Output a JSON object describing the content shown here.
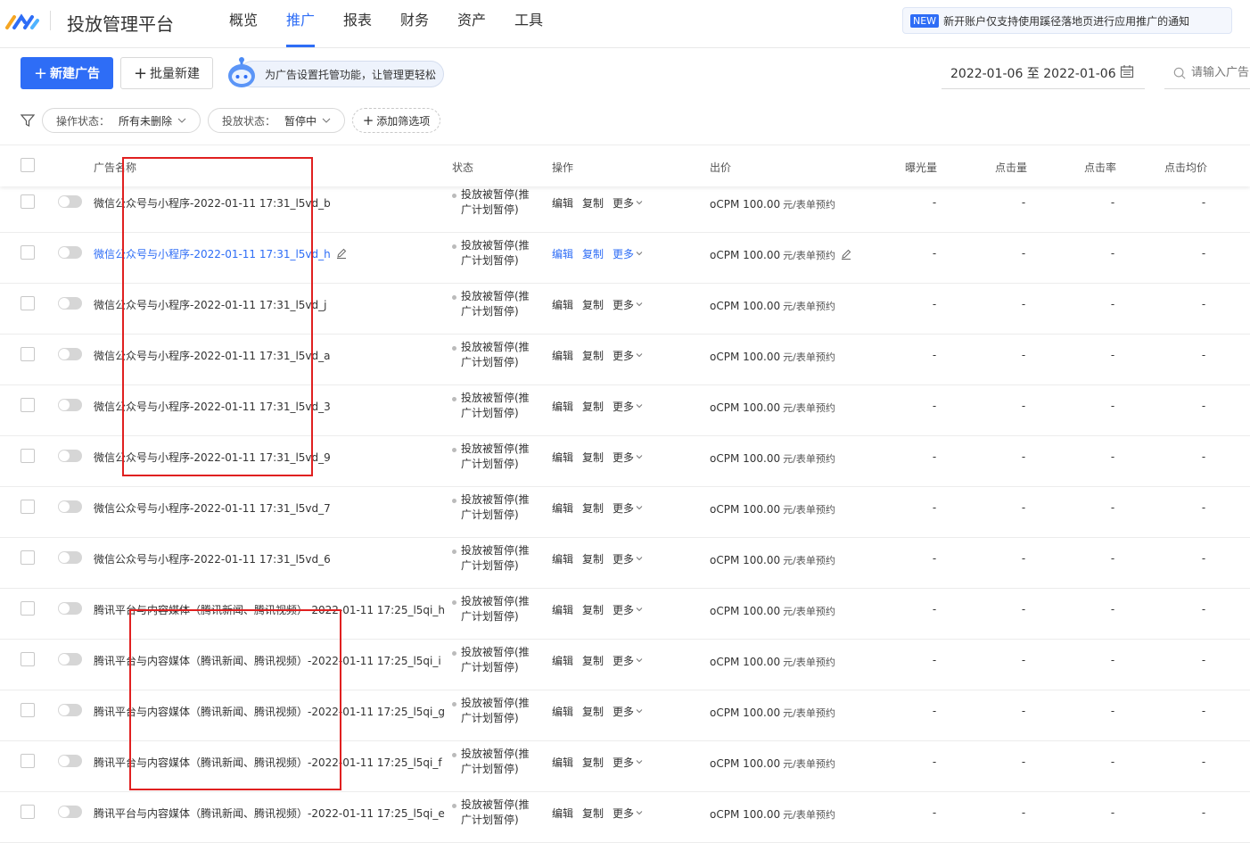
{
  "app": {
    "title": "投放管理平台"
  },
  "nav": [
    {
      "label": "概览",
      "active": false
    },
    {
      "label": "推广",
      "active": true
    },
    {
      "label": "报表",
      "active": false
    },
    {
      "label": "财务",
      "active": false
    },
    {
      "label": "资产",
      "active": false
    },
    {
      "label": "工具",
      "active": false
    }
  ],
  "notice": {
    "tag": "NEW",
    "text": "新开账户仅支持使用蹊径落地页进行应用推广的通知"
  },
  "toolbar": {
    "new_ad": "新建广告",
    "batch_new": "批量新建",
    "hint": "为广告设置托管功能，让管理更轻松",
    "date_range": "2022-01-06 至 2022-01-06",
    "search_placeholder": "请输入广告"
  },
  "filters": {
    "op_status_label": "操作状态：",
    "op_status_value": "所有未删除",
    "delivery_status_label": "投放状态：",
    "delivery_status_value": "暂停中",
    "add_filter": "添加筛选项"
  },
  "table": {
    "headers": {
      "name": "广告名称",
      "status": "状态",
      "ops": "操作",
      "bid": "出价",
      "impressions": "曝光量",
      "clicks": "点击量",
      "ctr": "点击率",
      "cpc": "点击均价"
    },
    "ops_labels": {
      "edit": "编辑",
      "copy": "复制",
      "more": "更多"
    },
    "status_text": "投放被暂停(推广计划暂停)",
    "bid_text": "oCPM  100.00",
    "bid_unit": "元/表单预约",
    "empty": "-",
    "rows": [
      {
        "name": "微信公众号与小程序-2022-01-11 17:31_l5vd_b"
      },
      {
        "name": "微信公众号与小程序-2022-01-11 17:31_l5vd_h"
      },
      {
        "name": "微信公众号与小程序-2022-01-11 17:31_l5vd_j"
      },
      {
        "name": "微信公众号与小程序-2022-01-11 17:31_l5vd_a"
      },
      {
        "name": "微信公众号与小程序-2022-01-11 17:31_l5vd_3"
      },
      {
        "name": "微信公众号与小程序-2022-01-11 17:31_l5vd_9"
      },
      {
        "name": "微信公众号与小程序-2022-01-11 17:31_l5vd_7"
      },
      {
        "name": "微信公众号与小程序-2022-01-11 17:31_l5vd_6"
      },
      {
        "name": "腾讯平台与内容媒体（腾讯新闻、腾讯视频）-2022-01-11 17:25_l5qi_h"
      },
      {
        "name": "腾讯平台与内容媒体（腾讯新闻、腾讯视频）-2022-01-11 17:25_l5qi_i"
      },
      {
        "name": "腾讯平台与内容媒体（腾讯新闻、腾讯视频）-2022-01-11 17:25_l5qi_g"
      },
      {
        "name": "腾讯平台与内容媒体（腾讯新闻、腾讯视频）-2022-01-11 17:25_l5qi_f"
      },
      {
        "name": "腾讯平台与内容媒体（腾讯新闻、腾讯视频）-2022-01-11 17:25_l5qi_e"
      }
    ]
  },
  "colors": {
    "accent": "#2e6df6",
    "highlight": "#e02020"
  }
}
